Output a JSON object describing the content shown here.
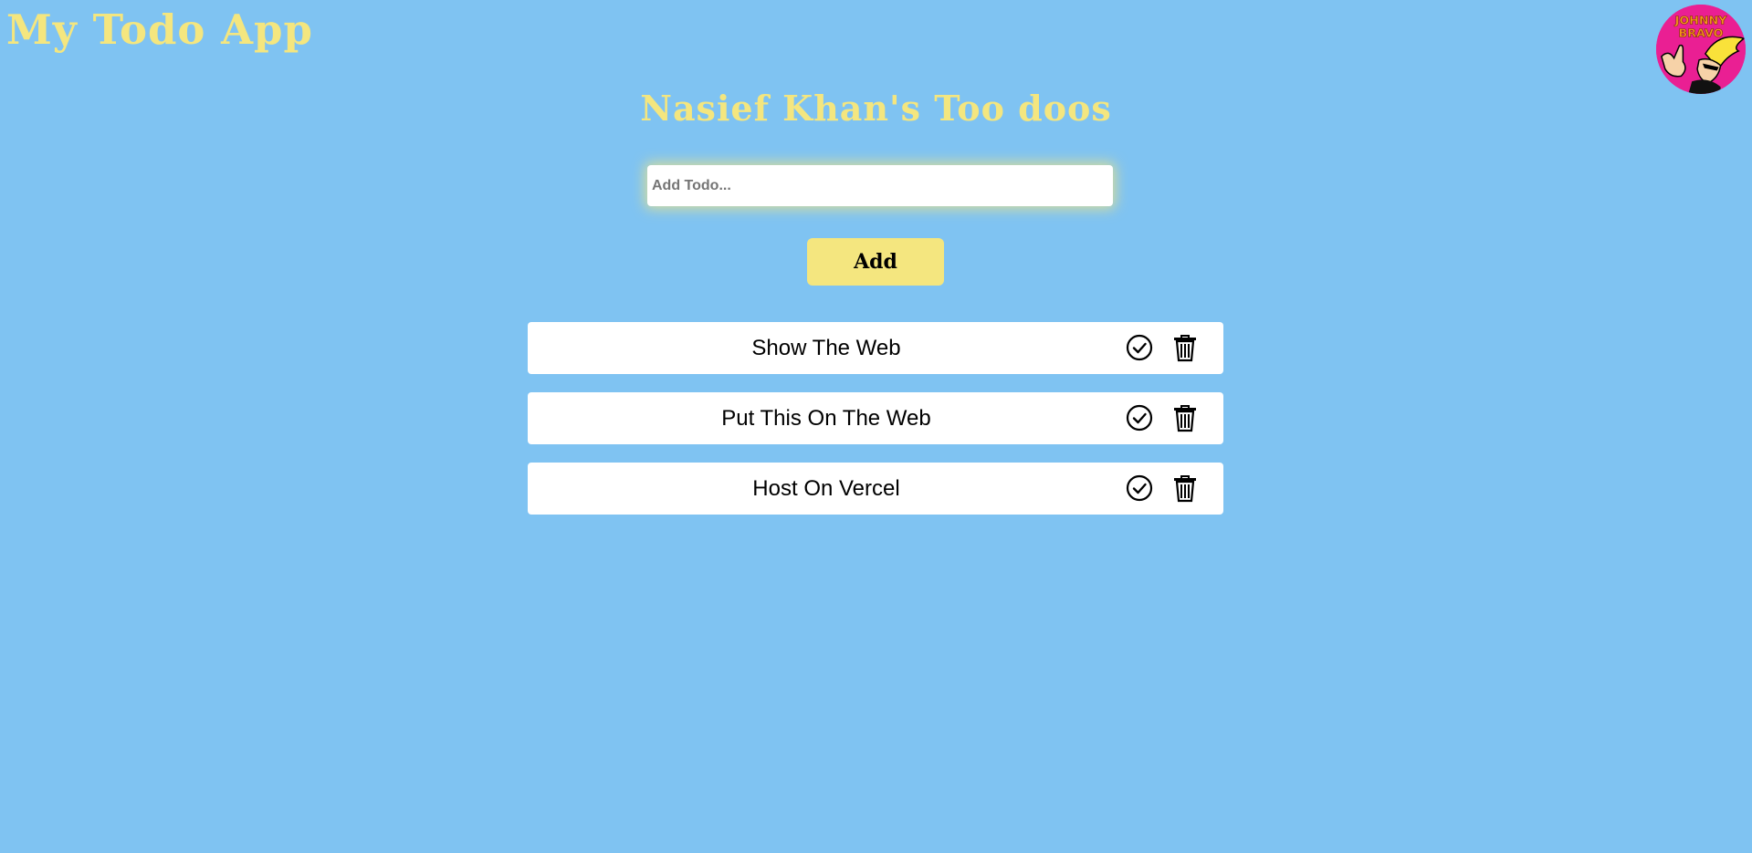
{
  "app": {
    "title": "My Todo App"
  },
  "header": {
    "heading": "Nasief Khan's Too doos",
    "avatar_icon": "johnny-bravo-avatar",
    "avatar_text": "JOHNNY BRAVO"
  },
  "form": {
    "input_placeholder": "Add Todo...",
    "input_value": "",
    "add_label": "Add"
  },
  "todos": [
    {
      "text": "Show The Web",
      "check_icon": "check-circle-icon",
      "delete_icon": "trash-icon"
    },
    {
      "text": "Put This On The Web",
      "check_icon": "check-circle-icon",
      "delete_icon": "trash-icon"
    },
    {
      "text": "Host On Vercel",
      "check_icon": "check-circle-icon",
      "delete_icon": "trash-icon"
    }
  ],
  "colors": {
    "background": "#7fc3f2",
    "accent": "#f4e67f",
    "avatar_bg": "#ea1f93"
  }
}
